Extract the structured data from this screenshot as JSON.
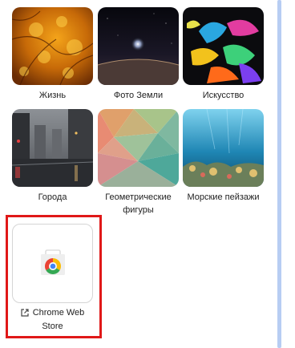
{
  "tiles": [
    {
      "label": "Жизнь",
      "image": "autumn-leaves-orange"
    },
    {
      "label": "Фото Земли",
      "image": "planet-horizon-night"
    },
    {
      "label": "Искусство",
      "image": "paint-splash-colorful"
    },
    {
      "label": "Города",
      "image": "city-wet-street"
    },
    {
      "label": "Геометрические фигуры",
      "image": "low-poly-gradient"
    },
    {
      "label": "Морские пейзажи",
      "image": "coral-reef-underwater"
    }
  ],
  "store": {
    "label": "Chrome Web Store",
    "icon": "chrome-web-store-icon",
    "link_icon": "external-link-icon"
  },
  "colors": {
    "highlight": "#e01818",
    "scrollbar": "#b7cdf3"
  }
}
